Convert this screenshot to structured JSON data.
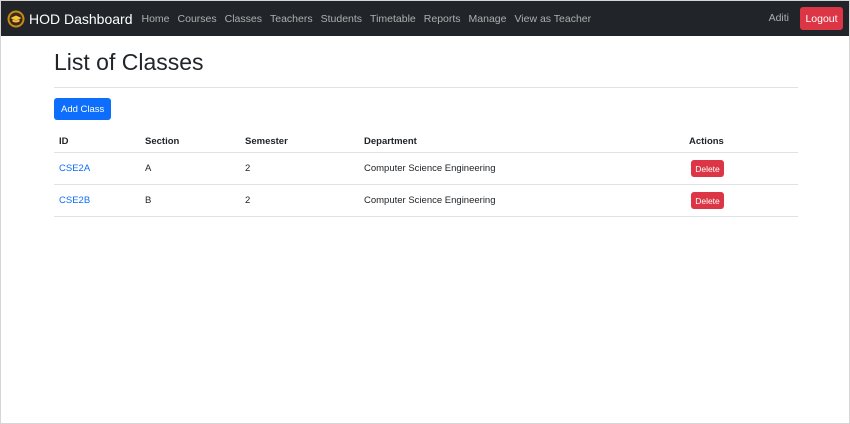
{
  "navbar": {
    "brand": "HOD Dashboard",
    "brand_icon": "graduation-logo-icon",
    "links": [
      "Home",
      "Courses",
      "Classes",
      "Teachers",
      "Students",
      "Timetable",
      "Reports",
      "Manage",
      "View as Teacher"
    ],
    "user": "Aditi",
    "logout": "Logout"
  },
  "main": {
    "title": "List of Classes",
    "add_button": "Add Class",
    "table": {
      "headers": [
        "ID",
        "Section",
        "Semester",
        "Department",
        "Actions"
      ],
      "rows": [
        {
          "id": "CSE2A",
          "section": "A",
          "semester": "2",
          "department": "Computer Science Engineering",
          "action": "Delete"
        },
        {
          "id": "CSE2B",
          "section": "B",
          "semester": "2",
          "department": "Computer Science Engineering",
          "action": "Delete"
        }
      ]
    }
  },
  "colors": {
    "navbar_bg": "#212529",
    "primary": "#0d6efd",
    "danger": "#dc3545"
  }
}
